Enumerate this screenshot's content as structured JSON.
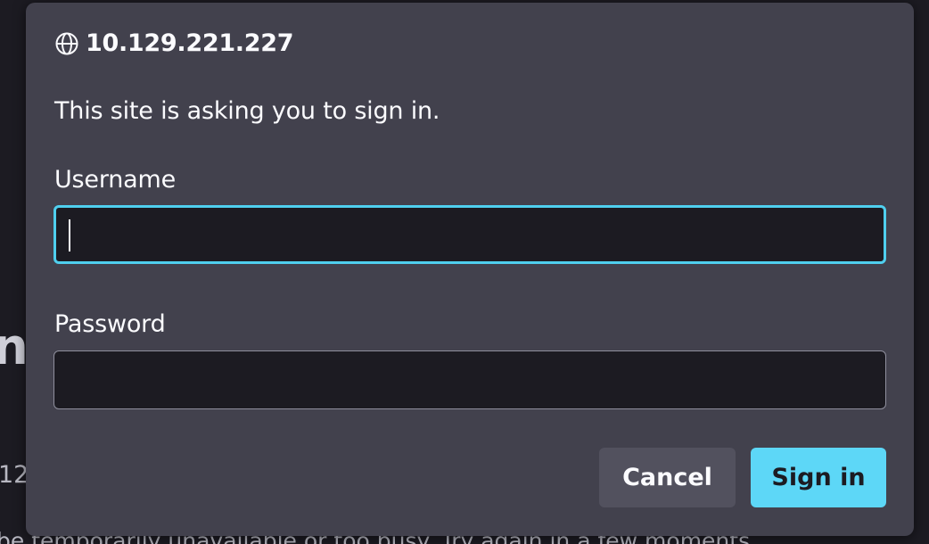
{
  "background": {
    "heading_fragment": "n",
    "number_fragment": "12",
    "text_fragment": "be temporarily unavailable or too busy. Try again in a few moments."
  },
  "dialog": {
    "host": "10.129.221.227",
    "host_icon": "globe-icon",
    "message": "This site is asking you to sign in.",
    "username_label": "Username",
    "username_value": "",
    "password_label": "Password",
    "password_value": "",
    "cancel_label": "Cancel",
    "signin_label": "Sign in"
  },
  "colors": {
    "dialog_bg": "#42414d",
    "field_bg": "#1c1b22",
    "focus_ring": "#4fcfee",
    "primary_button": "#5dd7f7",
    "secondary_button": "#52515e",
    "text": "#fbfbfe"
  }
}
